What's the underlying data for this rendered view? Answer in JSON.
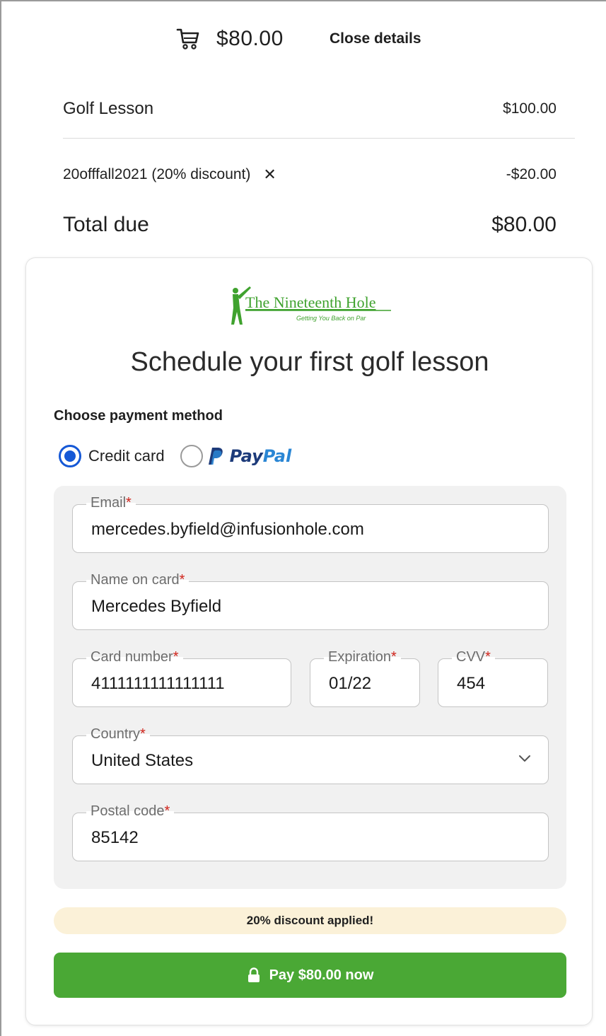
{
  "summary": {
    "amount": "$80.00",
    "close_label": "Close details"
  },
  "line_items": {
    "product_name": "Golf Lesson",
    "product_price": "$100.00",
    "discount_label": "20offfall2021 (20% discount)",
    "discount_remove": "✕",
    "discount_amount": "-$20.00",
    "total_label": "Total due",
    "total_amount": "$80.00"
  },
  "logo": {
    "name": "The Nineteenth Hole",
    "tagline": "Getting You Back on Par"
  },
  "form": {
    "title": "Schedule your first golf lesson",
    "payment_method_label": "Choose payment method",
    "credit_card_label": "Credit card",
    "paypal_pay": "Pay",
    "paypal_pal": "Pal",
    "required_mark": "*"
  },
  "fields": {
    "email": {
      "label": "Email",
      "value": "mercedes.byfield@infusionhole.com"
    },
    "name": {
      "label": "Name on card",
      "value": "Mercedes Byfield"
    },
    "card_number": {
      "label": "Card number",
      "value": "4111111111111111"
    },
    "expiration": {
      "label": "Expiration",
      "value": "01/22"
    },
    "cvv": {
      "label": "CVV",
      "value": "454"
    },
    "country": {
      "label": "Country",
      "value": "United States"
    },
    "postal": {
      "label": "Postal code",
      "value": "85142"
    }
  },
  "discount_banner": "20% discount applied!",
  "pay_button": "Pay $80.00 now",
  "colors": {
    "accent_green": "#4aa835",
    "radio_blue": "#1558d6",
    "required_red": "#d0241b",
    "banner_bg": "#fbf1d8",
    "logo_green": "#3fa22e"
  },
  "icons": {
    "cart": "cart-icon",
    "close": "close-icon",
    "chevron": "chevron-down-icon",
    "lock": "lock-icon",
    "paypal": "paypal-icon"
  }
}
